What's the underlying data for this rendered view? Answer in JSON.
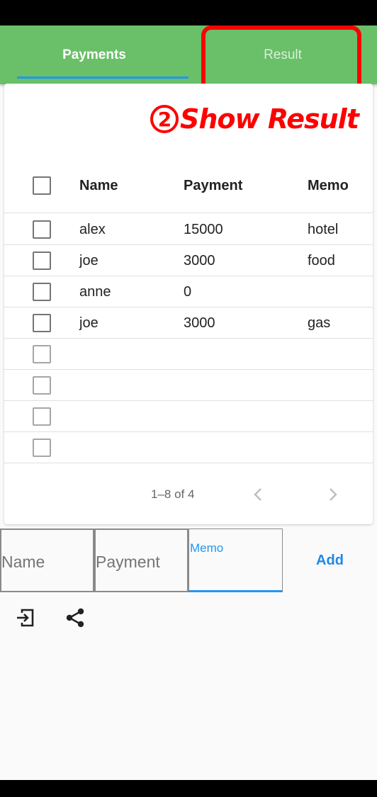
{
  "tabs": [
    {
      "label": "Payments",
      "selected": true
    },
    {
      "label": "Result",
      "selected": false
    }
  ],
  "annotation": {
    "number": "2",
    "text": "Show Result",
    "color": "#ff0000"
  },
  "table": {
    "headers": [
      "Name",
      "Payment",
      "Memo"
    ],
    "rows": [
      {
        "name": "alex",
        "payment": "15000",
        "memo": "hotel"
      },
      {
        "name": "joe",
        "payment": "3000",
        "memo": "food"
      },
      {
        "name": "anne",
        "payment": "0",
        "memo": ""
      },
      {
        "name": "joe",
        "payment": "3000",
        "memo": "gas"
      },
      {
        "name": "",
        "payment": "",
        "memo": ""
      },
      {
        "name": "",
        "payment": "",
        "memo": ""
      },
      {
        "name": "",
        "payment": "",
        "memo": ""
      },
      {
        "name": "",
        "payment": "",
        "memo": ""
      }
    ],
    "pagination": "1–8 of 4"
  },
  "form": {
    "name_placeholder": "Name",
    "payment_placeholder": "Payment",
    "memo_label": "Memo",
    "add_label": "Add"
  },
  "icons": [
    "select-all-checkbox",
    "prev-page-icon",
    "next-page-icon",
    "import-icon",
    "share-icon"
  ],
  "colors": {
    "appbar": "#6abf69",
    "accent": "#2196f3",
    "annotation": "#ff0000"
  }
}
